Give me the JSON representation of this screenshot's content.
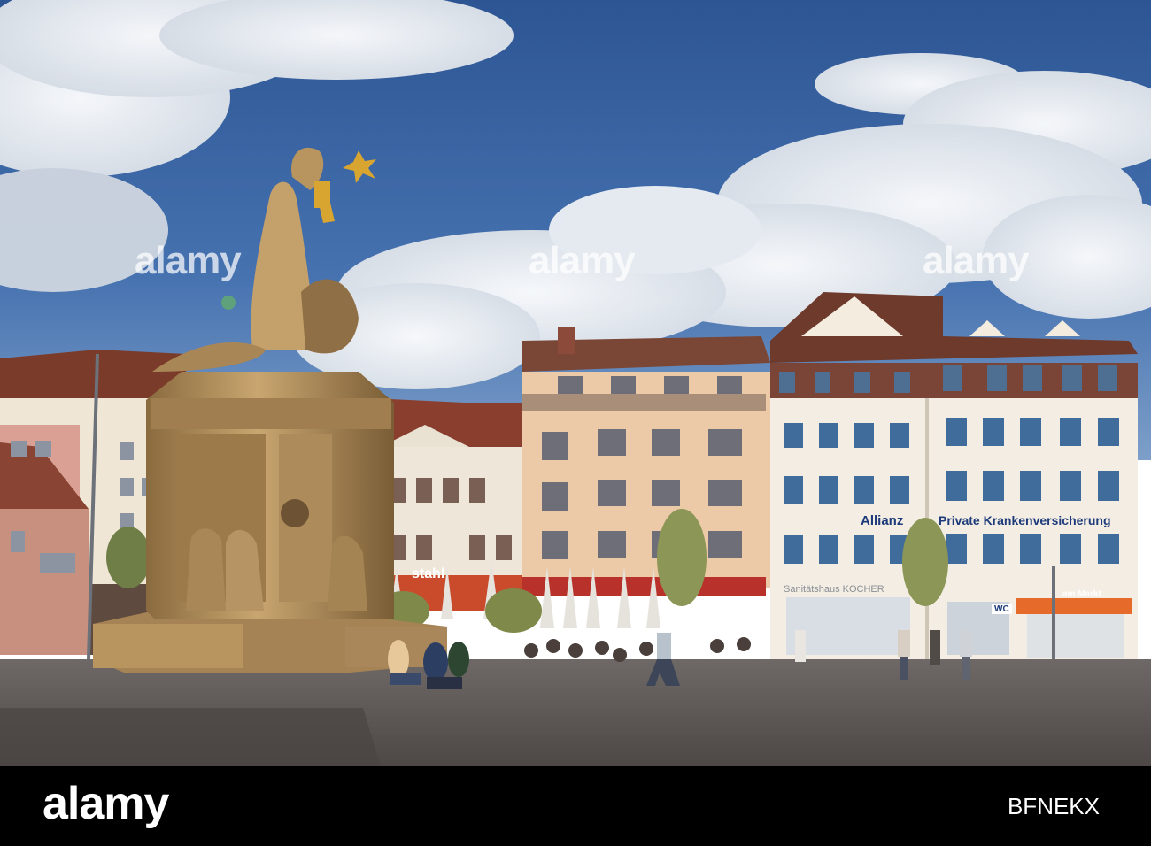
{
  "watermarks": [
    "alamy",
    "alamy",
    "alamy"
  ],
  "signs": {
    "allianz": "Allianz",
    "insurance": "Private Krankenversicherung",
    "stahl": "stahl",
    "kocher": "Sanitätshaus KOCHER",
    "wc": "WC",
    "markt": "am Markt"
  },
  "footer": {
    "logo": "alamy",
    "image_code": "BFNEKX"
  },
  "colors": {
    "sky": "#3a63a3",
    "footer": "#000000",
    "fountain_stone": "#b8955f",
    "pavement": "#5d5654"
  }
}
